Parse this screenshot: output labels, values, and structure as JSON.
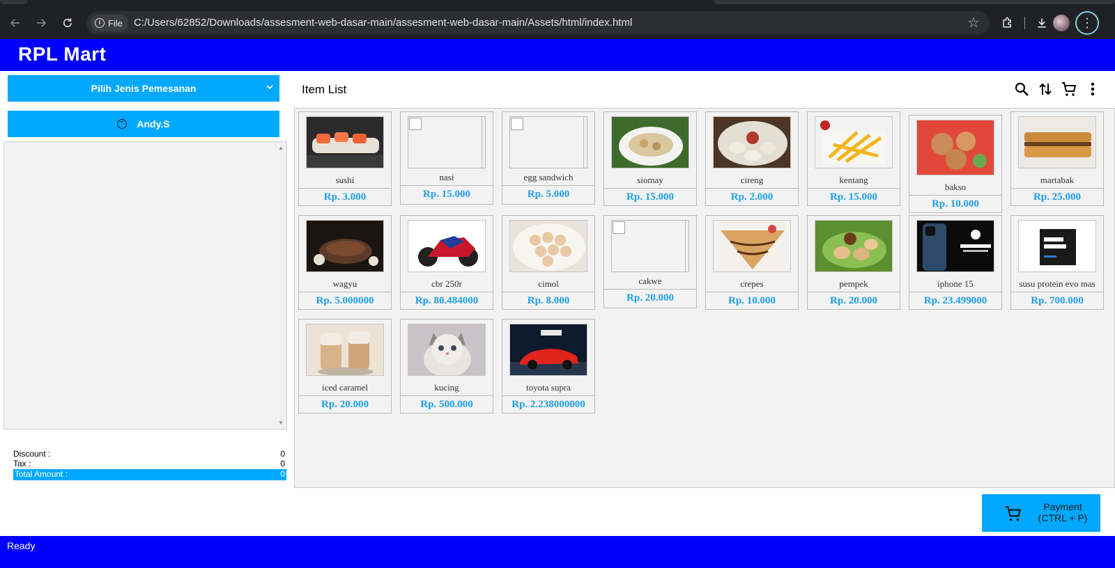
{
  "browser": {
    "url_chip": "File",
    "url": "C:/Users/62852/Downloads/assesment-web-dasar-main/assesment-web-dasar-main/Assets/html/index.html"
  },
  "app": {
    "title": "RPL Mart"
  },
  "sidebar": {
    "order_type_label": "Pilih Jenis Pemesanan",
    "user_label": "Andy.S",
    "totals": {
      "discount_label": "Discount :",
      "discount_value": "0",
      "tax_label": "Tax :",
      "tax_value": "0",
      "total_label": "Total Amount :",
      "total_value": "0"
    }
  },
  "main": {
    "title": "Item List",
    "items": [
      {
        "name": "sushi",
        "price": "Rp. 3.000",
        "image": "sushi"
      },
      {
        "name": "nasi",
        "price": "Rp. 15.000",
        "image": "broken"
      },
      {
        "name": "egg sandwich",
        "price": "Rp. 5.000",
        "image": "broken"
      },
      {
        "name": "siomay",
        "price": "Rp. 15.000",
        "image": "siomay"
      },
      {
        "name": "cireng",
        "price": "Rp. 2.000",
        "image": "cireng"
      },
      {
        "name": "kentang",
        "price": "Rp. 15.000",
        "image": "kentang"
      },
      {
        "name": "bakso",
        "price": "Rp. 10.000",
        "image": "bakso"
      },
      {
        "name": "martabak",
        "price": "Rp. 25.000",
        "image": "martabak"
      },
      {
        "name": "wagyu",
        "price": "Rp. 5.000000",
        "image": "wagyu"
      },
      {
        "name": "cbr 250r",
        "price": "Rp. 80.484000",
        "image": "cbr"
      },
      {
        "name": "cimol",
        "price": "Rp. 8.000",
        "image": "cimol"
      },
      {
        "name": "cakwe",
        "price": "Rp. 20.000",
        "image": "broken"
      },
      {
        "name": "crepes",
        "price": "Rp. 10.000",
        "image": "crepes"
      },
      {
        "name": "pempek",
        "price": "Rp. 20.000",
        "image": "pempek"
      },
      {
        "name": "iphone 15",
        "price": "Rp. 23.499000",
        "image": "iphone"
      },
      {
        "name": "susu protein evo mas",
        "price": "Rp. 700.000",
        "image": "evomass"
      },
      {
        "name": "iced caramel",
        "price": "Rp. 20.000",
        "image": "iced"
      },
      {
        "name": "kucing",
        "price": "Rp. 500.000",
        "image": "kucing"
      },
      {
        "name": "toyota supra",
        "price": "Rp. 2.238000000",
        "image": "supra"
      }
    ]
  },
  "payment": {
    "line1": "Payment",
    "line2": "(CTRL + P)"
  },
  "status": {
    "text": "Ready"
  },
  "colors": {
    "brand_blue": "#0000ff",
    "accent": "#00a8ff",
    "price": "#1e9fe6"
  }
}
